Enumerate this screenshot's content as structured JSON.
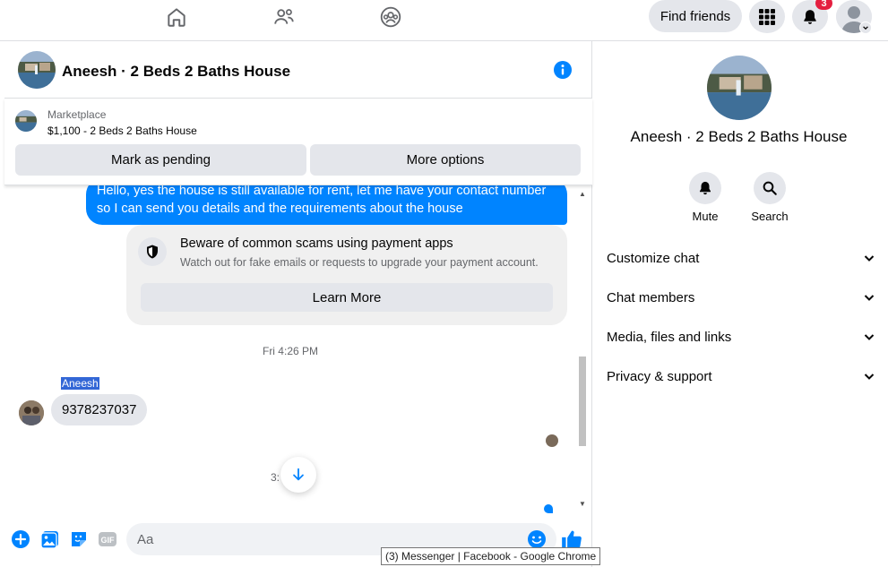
{
  "topbar": {
    "nav_icons": [
      "home-icon",
      "friends-icon",
      "groups-icon"
    ],
    "find_friends_label": "Find friends",
    "menu_icon": "grid-icon",
    "notifications_icon": "bell-icon",
    "notification_count": "3",
    "account_icon": "profile-icon"
  },
  "chat": {
    "title": "Aneesh · 2 Beds 2 Baths House",
    "marketplace": {
      "label": "Marketplace",
      "price_title": "$1,100 - 2 Beds 2 Baths House",
      "mark_pending_label": "Mark as pending",
      "more_options_label": "More options"
    },
    "messages": {
      "outgoing_text": "Hello, yes the house is still available for rent, let me have your contact number so I can send you details and the requirements about the house",
      "scam_title": "Beware of common scams using payment apps",
      "scam_subtitle": "Watch out for fake emails or requests to upgrade your payment account.",
      "learn_more_label": "Learn More",
      "timestamp": "Fri 4:26 PM",
      "sender_name": "Aneesh",
      "incoming_text": "9378237037",
      "partial_timestamp": "3:"
    },
    "composer": {
      "placeholder": "Aa"
    }
  },
  "tooltip": "(3) Messenger | Facebook - Google Chrome",
  "info_panel": {
    "title": "Aneesh · 2 Beds 2 Baths House",
    "actions": [
      {
        "label": "Mute",
        "icon": "bell-icon"
      },
      {
        "label": "Search",
        "icon": "search-icon"
      }
    ],
    "sections": [
      {
        "label": "Customize chat"
      },
      {
        "label": "Chat members"
      },
      {
        "label": "Media, files and links"
      },
      {
        "label": "Privacy & support"
      }
    ]
  },
  "colors": {
    "accent": "#0084ff",
    "badge": "#e41e3f",
    "bubble_in": "#e4e6eb"
  }
}
